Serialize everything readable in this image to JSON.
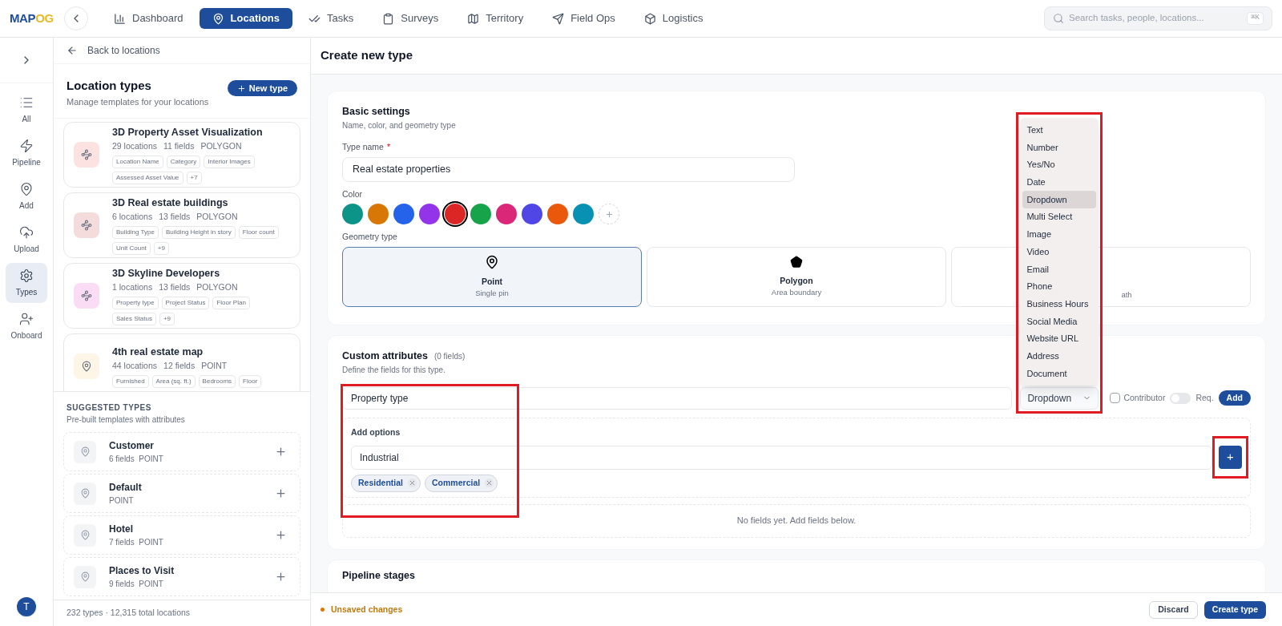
{
  "logo": {
    "left": "MAP",
    "right": "OG"
  },
  "nav": [
    {
      "label": "Dashboard",
      "selected": false
    },
    {
      "label": "Locations",
      "selected": true
    },
    {
      "label": "Tasks",
      "selected": false
    },
    {
      "label": "Surveys",
      "selected": false
    },
    {
      "label": "Territory",
      "selected": false
    },
    {
      "label": "Field Ops",
      "selected": false
    },
    {
      "label": "Logistics",
      "selected": false
    }
  ],
  "search": {
    "placeholder": "Search tasks, people, locations...",
    "shortcut": "⌘K"
  },
  "rail": [
    {
      "label": "All",
      "selected": false
    },
    {
      "label": "Pipeline",
      "selected": false
    },
    {
      "label": "Add",
      "selected": false
    },
    {
      "label": "Upload",
      "selected": false
    },
    {
      "label": "Types",
      "selected": true
    },
    {
      "label": "Onboard",
      "selected": false
    }
  ],
  "avatar": "T",
  "sidebar": {
    "back": "Back to locations",
    "title": "Location types",
    "subtitle": "Manage templates for your locations",
    "new_button": "New type",
    "types": [
      {
        "name": "3D Property Asset Visualization",
        "locations": "29 locations",
        "fields": "11 fields",
        "geometry": "POLYGON",
        "color": "#fde2e2",
        "tags": [
          "Location Name",
          "Category",
          "Interior Images",
          "Assessed Asset Value",
          "+7"
        ]
      },
      {
        "name": "3D Real estate buildings",
        "locations": "6 locations",
        "fields": "13 fields",
        "geometry": "POLYGON",
        "color": "#f5dcdc",
        "tags": [
          "Building Type",
          "Building Height in story",
          "Floor count",
          "Unit Count",
          "+9"
        ]
      },
      {
        "name": "3D Skyline Developers",
        "locations": "1 locations",
        "fields": "13 fields",
        "geometry": "POLYGON",
        "color": "#fbdcf5",
        "tags": [
          "Property type",
          "Project Status",
          "Floor Plan",
          "Sales Status",
          "+9"
        ]
      },
      {
        "name": "4th real estate map",
        "locations": "44 locations",
        "fields": "12 fields",
        "geometry": "POINT",
        "color": "#fdf5e6",
        "tags": [
          "Furnished",
          "Area (sq. ft.)",
          "Bedrooms",
          "Floor"
        ]
      }
    ],
    "suggested_title": "SUGGESTED TYPES",
    "suggested_subtitle": "Pre-built templates with attributes",
    "suggested": [
      {
        "name": "Customer",
        "meta": "6 fields  POINT"
      },
      {
        "name": "Default",
        "meta": "POINT"
      },
      {
        "name": "Hotel",
        "meta": "7 fields  POINT"
      },
      {
        "name": "Places to Visit",
        "meta": "9 fields  POINT"
      }
    ],
    "footer": "232 types · 12,315 total locations"
  },
  "main": {
    "title": "Create new type",
    "basic": {
      "title": "Basic settings",
      "subtitle": "Name, color, and geometry type",
      "name_label": "Type name",
      "required_mark": "*",
      "name_value": "Real estate properties",
      "color_label": "Color",
      "colors": [
        {
          "color": "#0d9488",
          "selected": false
        },
        {
          "color": "#d97706",
          "selected": false
        },
        {
          "color": "#2563eb",
          "selected": false
        },
        {
          "color": "#9333ea",
          "selected": false
        },
        {
          "color": "#dc2626",
          "selected": true
        },
        {
          "color": "#16a34a",
          "selected": false
        },
        {
          "color": "#db2777",
          "selected": false
        },
        {
          "color": "#4f46e5",
          "selected": false
        },
        {
          "color": "#ea580c",
          "selected": false
        },
        {
          "color": "#0891b2",
          "selected": false
        }
      ],
      "geometry_label": "Geometry type",
      "geometry": [
        {
          "kind": "point",
          "label": "Point",
          "sublabel": "Single pin",
          "selected": true
        },
        {
          "kind": "polygon",
          "label": "Polygon",
          "sublabel": "Area boundary",
          "selected": false
        },
        {
          "kind": "line",
          "sublabel": "ath",
          "selected": false
        }
      ]
    },
    "custom": {
      "title": "Custom attributes",
      "count": "(0 fields)",
      "subtitle": "Define the fields for this type.",
      "field_value": "Property type",
      "type_value": "Dropdown",
      "contributor": {
        "label": "Contributor",
        "checked": false
      },
      "required": {
        "label": "Req.",
        "on": false
      },
      "add_button": "Add",
      "options_label": "Add options",
      "option_value": "Industrial",
      "add_option_icon": "+",
      "chips": [
        "Residential",
        "Commercial"
      ],
      "empty": "No fields yet. Add fields below.",
      "menu": [
        {
          "label": "Text",
          "selected": false
        },
        {
          "label": "Number",
          "selected": false
        },
        {
          "label": "Yes/No",
          "selected": false
        },
        {
          "label": "Date",
          "selected": false
        },
        {
          "label": "Dropdown",
          "selected": true
        },
        {
          "label": "Multi Select",
          "selected": false
        },
        {
          "label": "Image",
          "selected": false
        },
        {
          "label": "Video",
          "selected": false
        },
        {
          "label": "Email",
          "selected": false
        },
        {
          "label": "Phone",
          "selected": false
        },
        {
          "label": "Business Hours",
          "selected": false
        },
        {
          "label": "Social Media",
          "selected": false
        },
        {
          "label": "Website URL",
          "selected": false
        },
        {
          "label": "Address",
          "selected": false
        },
        {
          "label": "Document",
          "selected": false
        }
      ]
    },
    "pipeline": {
      "title": "Pipeline stages"
    },
    "status": "Unsaved changes",
    "discard": "Discard",
    "create": "Create type"
  }
}
